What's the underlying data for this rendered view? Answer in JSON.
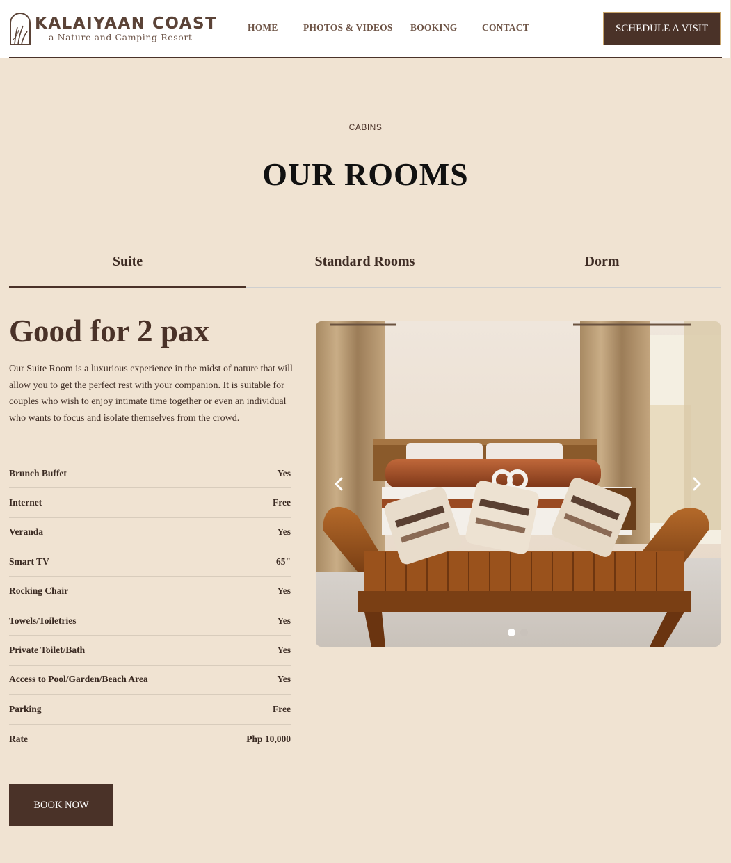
{
  "brand": {
    "name": "KALAIYAAN COAST",
    "tagline": "a Nature and Camping Resort"
  },
  "nav": {
    "items": [
      "HOME",
      "PHOTOS & VIDEOS",
      "BOOKING",
      "CONTACT"
    ],
    "cta": "SCHEDULE A VISIT"
  },
  "section": {
    "eyebrow": "CABINS",
    "title": "OUR ROOMS"
  },
  "tabs": {
    "items": [
      "Suite",
      "Standard Rooms",
      "Dorm"
    ],
    "active": "Suite"
  },
  "room": {
    "heading": "Good for 2 pax",
    "description": "Our Suite Room is a luxurious experience in the midst of nature that will allow you to get the perfect rest with your companion. It is suitable for couples who wish to enjoy intimate time together or even an individual who wants to focus and isolate themselves from the crowd.",
    "amenities": [
      {
        "label": "Brunch Buffet",
        "value": "Yes"
      },
      {
        "label": "Internet",
        "value": "Free"
      },
      {
        "label": "Veranda",
        "value": "Yes"
      },
      {
        "label": "Smart TV",
        "value": "65\""
      },
      {
        "label": "Rocking Chair",
        "value": "Yes"
      },
      {
        "label": "Towels/Toiletries",
        "value": "Yes"
      },
      {
        "label": "Private Toilet/Bath",
        "value": "Yes"
      },
      {
        "label": "Access to Pool/Garden/Beach Area",
        "value": "Yes"
      },
      {
        "label": "Parking",
        "value": "Free"
      },
      {
        "label": "Rate",
        "value": "Php 10,000"
      }
    ],
    "book_label": "BOOK NOW"
  },
  "carousel": {
    "slide_count": 2,
    "active_slide": 1,
    "prev_icon": "chevron-left-icon",
    "next_icon": "chevron-right-icon"
  },
  "colors": {
    "background": "#f0e3d2",
    "brand_brown": "#4a3228",
    "nav_text": "#6e5446",
    "cta_border": "#c8a46a"
  }
}
